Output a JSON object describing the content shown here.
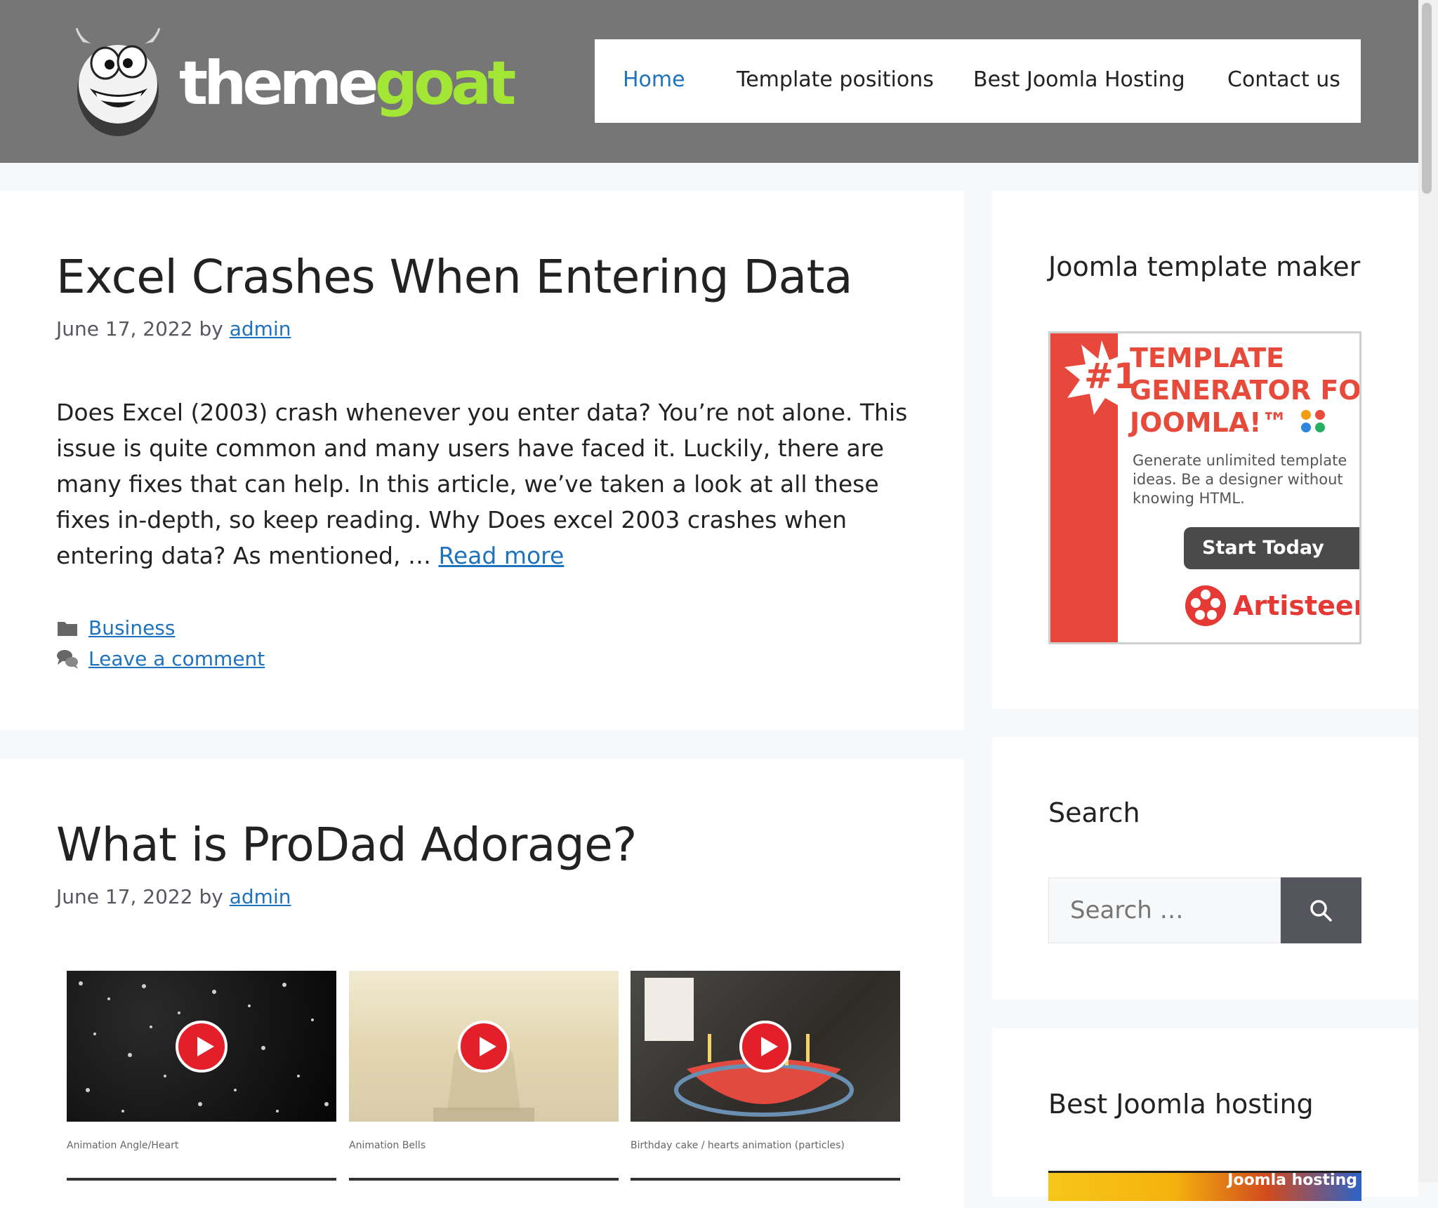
{
  "header": {
    "logo_part1": "theme",
    "logo_part2": "goat",
    "nav": [
      "Home",
      "Template positions",
      "Best Joomla Hosting",
      "Contact us"
    ]
  },
  "articles": [
    {
      "title": "Excel Crashes When Entering Data",
      "date": "June 17, 2022",
      "by": "by",
      "author": "admin",
      "excerpt": "Does Excel (2003) crash whenever you enter data? You’re not alone. This issue is quite common and many users have faced it. Luckily, there are many fixes that can help. In this article, we’ve taken a look at all these fixes in-depth, so keep reading. Why Does excel 2003 crashes when entering data? As mentioned, … ",
      "read_more": "Read more",
      "category": "Business",
      "comment_link": "Leave a comment"
    },
    {
      "title": "What is ProDad Adorage?",
      "date": "June 17, 2022",
      "by": "by",
      "author": "admin",
      "gallery": [
        {
          "caption": "Animation Angle/Heart"
        },
        {
          "caption": "Animation Bells"
        },
        {
          "caption": "Birthday cake / hearts animation (particles)"
        }
      ]
    }
  ],
  "sidebar": {
    "template_widget": {
      "title": "Joomla template maker",
      "ad": {
        "badge": "#1",
        "headline": [
          "TEMPLATE",
          "GENERATOR FOR",
          "JOOMLA!™"
        ],
        "body": "Generate unlimited template ideas. Be a designer without knowing HTML.",
        "button": "Start Today",
        "brand": "Artisteer"
      }
    },
    "search_widget": {
      "title": "Search",
      "placeholder": "Search …"
    },
    "hosting_widget": {
      "title": "Best Joomla hosting",
      "banner_text": "Joomla hosting"
    }
  },
  "colors": {
    "header_bg": "#767676",
    "link": "#1e73be",
    "logo_accent": "#a3e635",
    "ad_red": "#e64a3b",
    "search_button": "#55555e"
  }
}
